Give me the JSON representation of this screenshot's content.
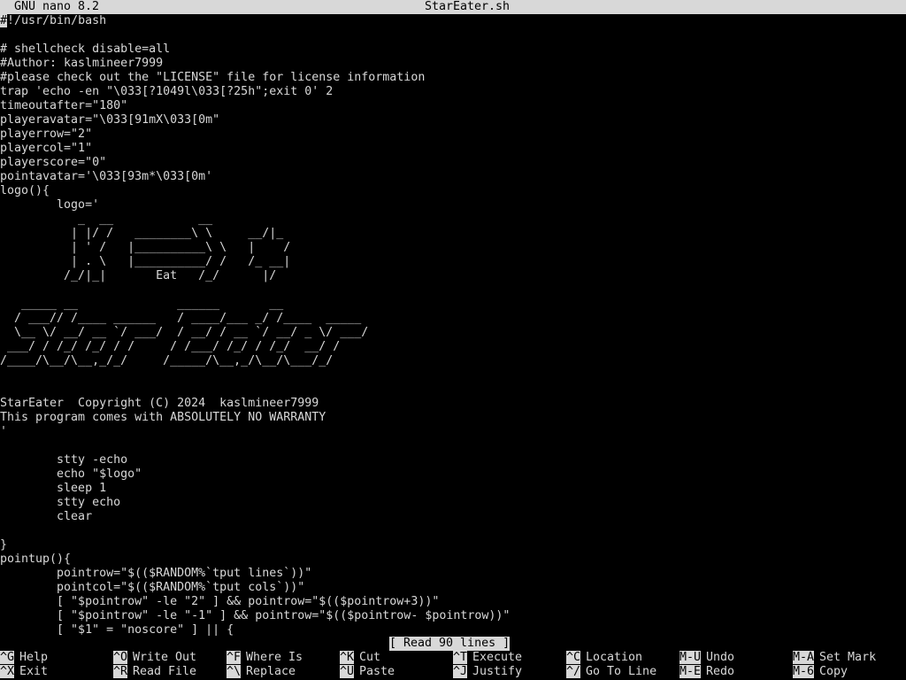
{
  "titlebar": {
    "app": "GNU nano 8.2",
    "filename": "StarEater.sh"
  },
  "editor": {
    "cursor_char": "#",
    "lines": [
      "!/usr/bin/bash",
      "",
      "# shellcheck disable=all",
      "#Author: kaslmineer7999",
      "#please check out the \"LICENSE\" file for license information",
      "trap 'echo -en \"\\033[?1049l\\033[?25h\";exit 0' 2",
      "timeoutafter=\"180\"",
      "playeravatar=\"\\033[91mX\\033[0m\"",
      "playerrow=\"2\"",
      "playercol=\"1\"",
      "playerscore=\"0\"",
      "pointavatar='\\033[93m*\\033[0m'",
      "logo(){",
      "        logo='",
      "           _  __            __",
      "          | |/ /   ________\\ \\     __/|_",
      "          | ' /   |__________\\ \\   |    /",
      "          | . \\   |__________/ /   /_ __|",
      "         /_/|_|       Eat   /_/      |/",
      "",
      "   _____ __              ______       __",
      "  / ___// /____ ______   / ____/___ _/ /____  _____",
      "  \\__ \\/ __/ __ `/ ___/  / __/ / __ `/ __/ _ \\/ ___/",
      " ___/ / /_/ /_/ / /     / /___/ /_/ / /_/  __/ /",
      "/____/\\__/\\__,_/_/     /_____/\\__,_/\\__/\\___/_/",
      "",
      "",
      "StarEater  Copyright (C) 2024  kaslmineer7999",
      "This program comes with ABSOLUTELY NO WARRANTY",
      "'",
      "",
      "        stty -echo",
      "        echo \"$logo\"",
      "        sleep 1",
      "        stty echo",
      "        clear",
      "",
      "}",
      "pointup(){",
      "        pointrow=\"$(($RANDOM%`tput lines`))\"",
      "        pointcol=\"$(($RANDOM%`tput cols`))\"",
      "        [ \"$pointrow\" -le \"2\" ] && pointrow=\"$(($pointrow+3))\"",
      "        [ \"$pointrow\" -le \"-1\" ] && pointrow=\"$(($pointrow- $pointrow))\"",
      "        [ \"$1\" = \"noscore\" ] || {"
    ]
  },
  "status": "[ Read 90 lines ]",
  "shortcuts": {
    "row1": [
      {
        "key": "^G",
        "label": "Help"
      },
      {
        "key": "^O",
        "label": "Write Out"
      },
      {
        "key": "^F",
        "label": "Where Is"
      },
      {
        "key": "^K",
        "label": "Cut"
      },
      {
        "key": "^T",
        "label": "Execute"
      },
      {
        "key": "^C",
        "label": "Location"
      },
      {
        "key": "M-U",
        "label": "Undo"
      },
      {
        "key": "M-A",
        "label": "Set Mark"
      }
    ],
    "row2": [
      {
        "key": "^X",
        "label": "Exit"
      },
      {
        "key": "^R",
        "label": "Read File"
      },
      {
        "key": "^\\",
        "label": "Replace"
      },
      {
        "key": "^U",
        "label": "Paste"
      },
      {
        "key": "^J",
        "label": "Justify"
      },
      {
        "key": "^/",
        "label": "Go To Line"
      },
      {
        "key": "M-E",
        "label": "Redo"
      },
      {
        "key": "M-6",
        "label": "Copy"
      }
    ]
  }
}
